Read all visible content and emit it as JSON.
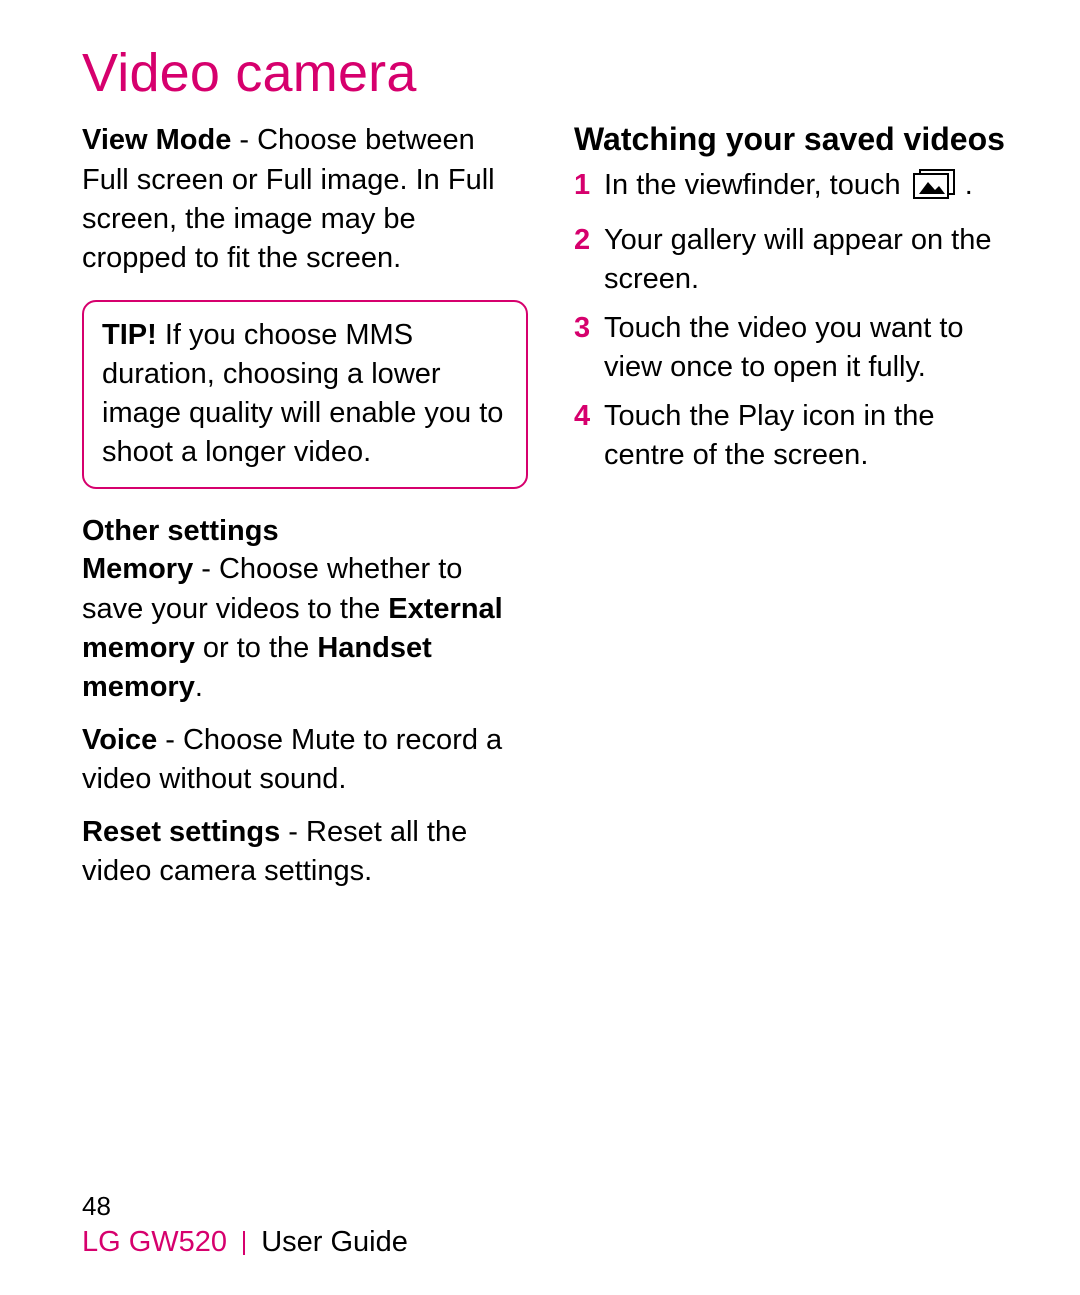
{
  "title": "Video camera",
  "left": {
    "view_mode": {
      "label": "View Mode",
      "text": " - Choose between Full screen or Full image. In Full screen, the image may be cropped to fit the screen."
    },
    "tip": {
      "label": "TIP!",
      "text": " If you choose MMS duration, choosing a lower image quality will enable you to shoot a longer video."
    },
    "other_settings_heading": "Other settings",
    "memory": {
      "label": "Memory",
      "pre": " - Choose whether to save your videos to the ",
      "bold1": "External memory",
      "mid": " or to the ",
      "bold2": "Handset memory",
      "post": "."
    },
    "voice": {
      "label": "Voice",
      "text": " - Choose Mute to record a video without sound."
    },
    "reset": {
      "label": "Reset settings",
      "text": " - Reset all the video camera settings."
    }
  },
  "right": {
    "heading": "Watching your saved videos",
    "steps": [
      {
        "num": "1",
        "pre": "In the viewfinder, touch ",
        "icon": "gallery-icon",
        "post": " ."
      },
      {
        "num": "2",
        "text": "Your gallery will appear on the screen."
      },
      {
        "num": "3",
        "text": "Touch the video you want to view once to open it fully."
      },
      {
        "num": "4",
        "text": "Touch the Play icon in the centre of the screen."
      }
    ]
  },
  "footer": {
    "page_number": "48",
    "model": "LG GW520",
    "guide": "User Guide"
  }
}
